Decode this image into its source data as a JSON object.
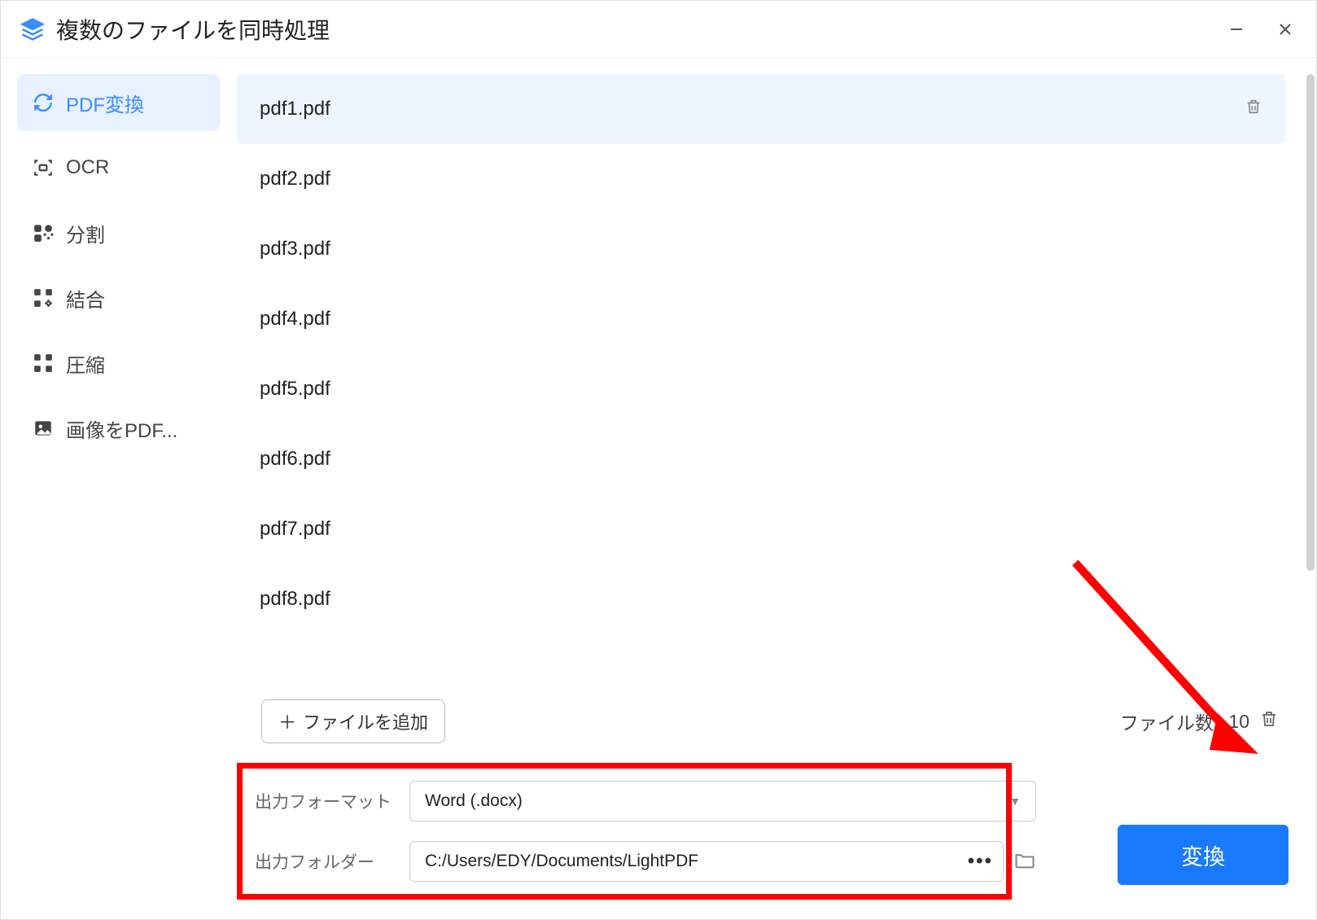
{
  "window": {
    "title": "複数のファイルを同時処理"
  },
  "sidebar": {
    "items": [
      {
        "label": "PDF変換",
        "active": true
      },
      {
        "label": "OCR",
        "active": false
      },
      {
        "label": "分割",
        "active": false
      },
      {
        "label": "結合",
        "active": false
      },
      {
        "label": "圧縮",
        "active": false
      },
      {
        "label": "画像をPDF...",
        "active": false
      }
    ]
  },
  "files": [
    {
      "name": "pdf1.pdf",
      "selected": true
    },
    {
      "name": "pdf2.pdf",
      "selected": false
    },
    {
      "name": "pdf3.pdf",
      "selected": false
    },
    {
      "name": "pdf4.pdf",
      "selected": false
    },
    {
      "name": "pdf5.pdf",
      "selected": false
    },
    {
      "name": "pdf6.pdf",
      "selected": false
    },
    {
      "name": "pdf7.pdf",
      "selected": false
    },
    {
      "name": "pdf8.pdf",
      "selected": false
    }
  ],
  "toolbar": {
    "add_file_label": "ファイルを追加",
    "file_count_label": "ファイル数:",
    "file_count_value": "10"
  },
  "output": {
    "format_label": "出力フォーマット",
    "format_value": "Word (.docx)",
    "folder_label": "出力フォルダー",
    "folder_value": "C:/Users/EDY/Documents/LightPDF"
  },
  "actions": {
    "convert_label": "変換"
  }
}
